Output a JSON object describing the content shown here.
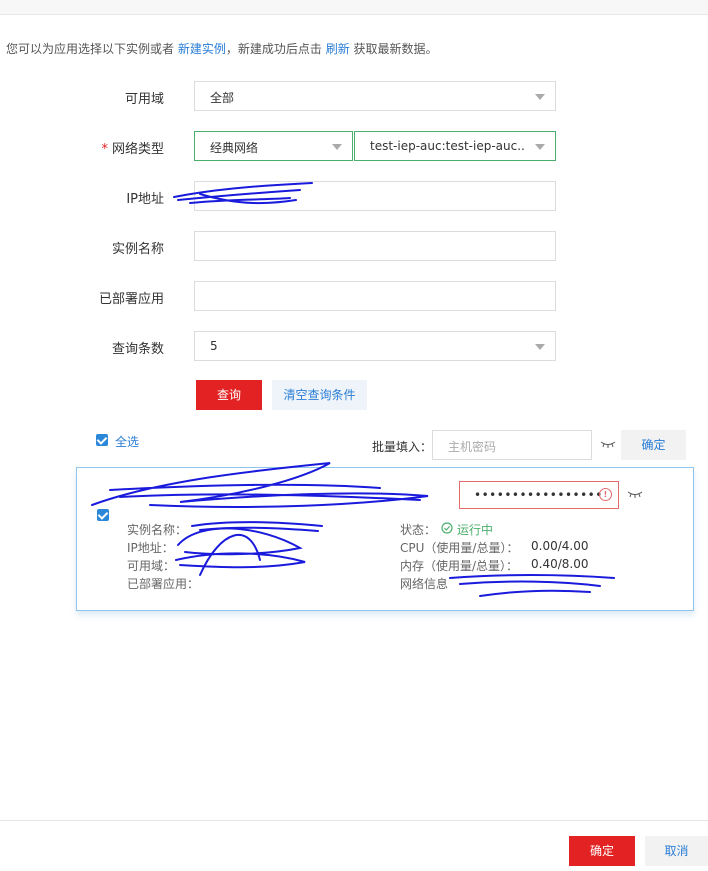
{
  "intro": {
    "prefix": "您可以为应用选择以下实例或者",
    "new_instance_link": "新建实例",
    "middle": "，新建成功后点击",
    "refresh_link": "刷新",
    "suffix": "获取最新数据。"
  },
  "form": {
    "zone": {
      "label": "可用域",
      "value": "全部"
    },
    "network_type": {
      "required_mark": "*",
      "label": "网络类型",
      "value": "经典网络",
      "vpc_value": "test-iep-auc:test-iep-auc..."
    },
    "ip": {
      "label": "IP地址",
      "value": ""
    },
    "instance_name": {
      "label": "实例名称",
      "value": ""
    },
    "deployed_app": {
      "label": "已部署应用",
      "value": ""
    },
    "query_count": {
      "label": "查询条数",
      "value": "5"
    }
  },
  "buttons": {
    "query": "查询",
    "clear": "清空查询条件",
    "batch_confirm": "确定",
    "ok": "确定",
    "cancel": "取消"
  },
  "select_all": "全选",
  "batch": {
    "label": "批量填入：",
    "placeholder": "主机密码"
  },
  "instance": {
    "password_mask": "•••••••••••••••••",
    "name_label": "实例名称：",
    "ip_label": "IP地址：",
    "zone_label": "可用域：",
    "deployed_label": "已部署应用：",
    "status_label": "状态：",
    "status_value": "运行中",
    "cpu_label": "CPU（使用量/总量）：",
    "cpu_value": "0.00/4.00",
    "memory_label": "内存（使用量/总量）：",
    "memory_value": "0.40/8.00",
    "network_label": "网络信息"
  },
  "colors": {
    "primary_red": "#e32323",
    "link_blue": "#2b7dd6",
    "status_green": "#4cae6c"
  }
}
